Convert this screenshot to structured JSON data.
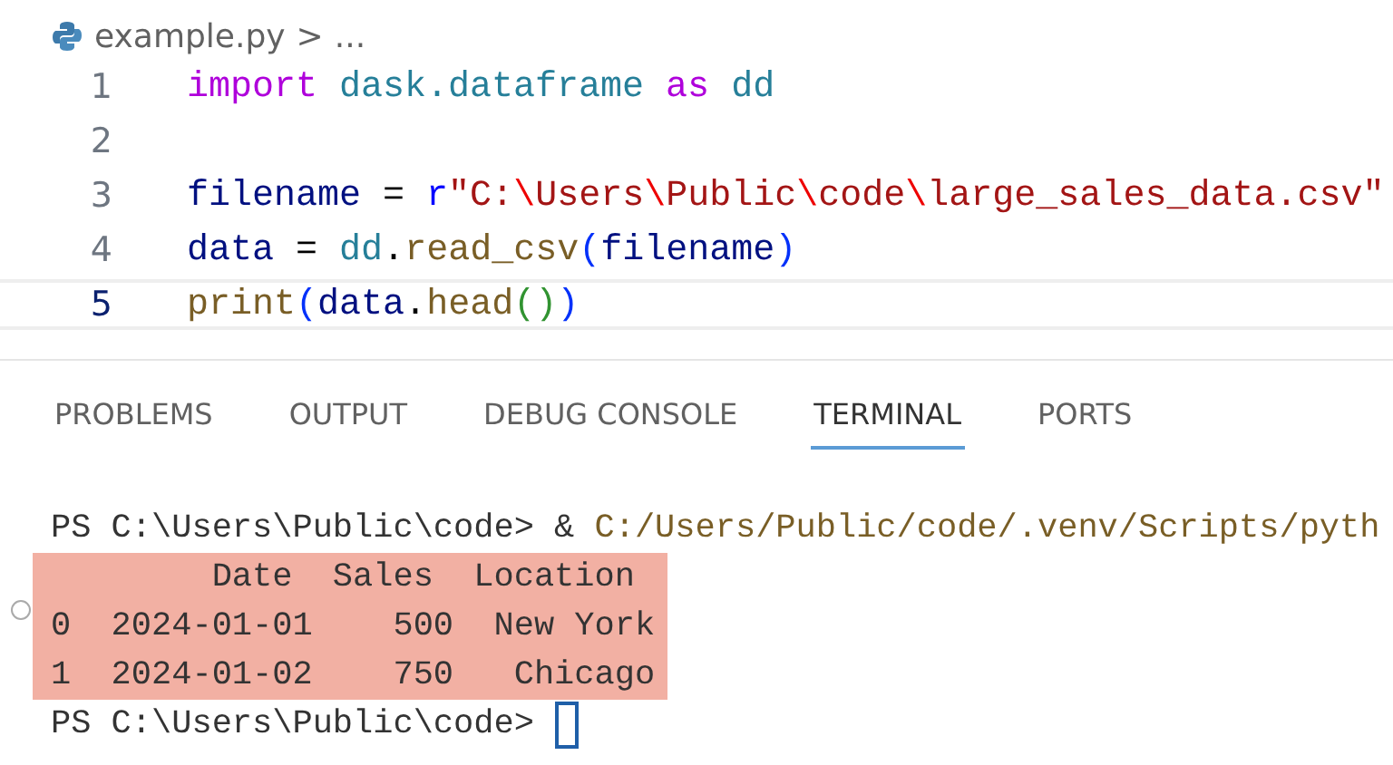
{
  "breadcrumb": {
    "file": "example.py",
    "separator": ">",
    "more": "..."
  },
  "editor": {
    "lines": [
      {
        "number": "1",
        "active": false,
        "tokens": [
          {
            "kind": "keyword",
            "text": "import "
          },
          {
            "kind": "module",
            "text": "dask.dataframe "
          },
          {
            "kind": "keyword",
            "text": "as "
          },
          {
            "kind": "module",
            "text": "dd"
          }
        ]
      },
      {
        "number": "2",
        "active": false
      },
      {
        "number": "3",
        "active": false,
        "tokens": [
          {
            "kind": "variable",
            "text": "filename"
          },
          {
            "kind": "plain",
            "text": " = "
          },
          {
            "kind": "prefix",
            "text": "r"
          },
          {
            "kind": "string",
            "text": "\"C:"
          },
          {
            "kind": "escape",
            "text": "\\"
          },
          {
            "kind": "string",
            "text": "Users"
          },
          {
            "kind": "escape",
            "text": "\\"
          },
          {
            "kind": "string",
            "text": "Public"
          },
          {
            "kind": "escape",
            "text": "\\"
          },
          {
            "kind": "string",
            "text": "code"
          },
          {
            "kind": "escape",
            "text": "\\"
          },
          {
            "kind": "string",
            "text": "large_sales_data.csv\""
          }
        ]
      },
      {
        "number": "4",
        "active": false,
        "tokens": [
          {
            "kind": "variable",
            "text": "data"
          },
          {
            "kind": "plain",
            "text": " = "
          },
          {
            "kind": "module",
            "text": "dd"
          },
          {
            "kind": "plain",
            "text": "."
          },
          {
            "kind": "function",
            "text": "read_csv"
          },
          {
            "kind": "bracket1",
            "text": "("
          },
          {
            "kind": "variable",
            "text": "filename"
          },
          {
            "kind": "bracket1",
            "text": ")"
          }
        ]
      },
      {
        "number": "5",
        "active": true,
        "tokens": [
          {
            "kind": "function",
            "text": "print"
          },
          {
            "kind": "bracket1",
            "text": "("
          },
          {
            "kind": "variable",
            "text": "data"
          },
          {
            "kind": "plain",
            "text": "."
          },
          {
            "kind": "function",
            "text": "head"
          },
          {
            "kind": "bracket2",
            "text": "()"
          },
          {
            "kind": "bracket1",
            "text": ")"
          }
        ]
      }
    ]
  },
  "panel": {
    "tabs": [
      {
        "label": "PROBLEMS",
        "selected": false
      },
      {
        "label": "OUTPUT",
        "selected": false
      },
      {
        "label": "DEBUG CONSOLE",
        "selected": false
      },
      {
        "label": "TERMINAL",
        "selected": true
      },
      {
        "label": "PORTS",
        "selected": false
      }
    ],
    "terminal": {
      "command_prompt": "PS C:\\Users\\Public\\code> & ",
      "command": "C:/Users/Public/code/.venv/Scripts/pyth",
      "output": {
        "highlighted": true,
        "lines": [
          "        Date  Sales  Location",
          "0  2024-01-01    500  New York",
          "1  2024-01-02    750   Chicago"
        ]
      },
      "prompt": "PS C:\\Users\\Public\\code> "
    }
  }
}
